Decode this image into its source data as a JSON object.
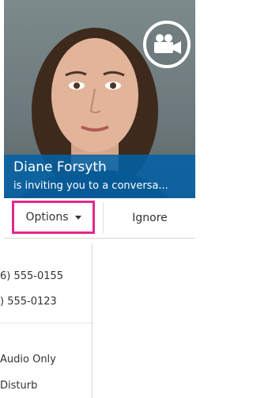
{
  "caller": {
    "name": "Diane Forsyth",
    "invite_text": "is inviting you to a conversa..."
  },
  "buttons": {
    "options_label": "Options",
    "ignore_label": "Ignore"
  },
  "menu": {
    "items": [
      "6) 555-0155",
      ") 555-0123",
      "Audio Only",
      "Disturb"
    ]
  },
  "colors": {
    "caption_bg": "#0062a8",
    "highlight": "#e3288f"
  },
  "icons": {
    "video": "video-camera-icon",
    "dropdown": "chevron-down-icon"
  }
}
